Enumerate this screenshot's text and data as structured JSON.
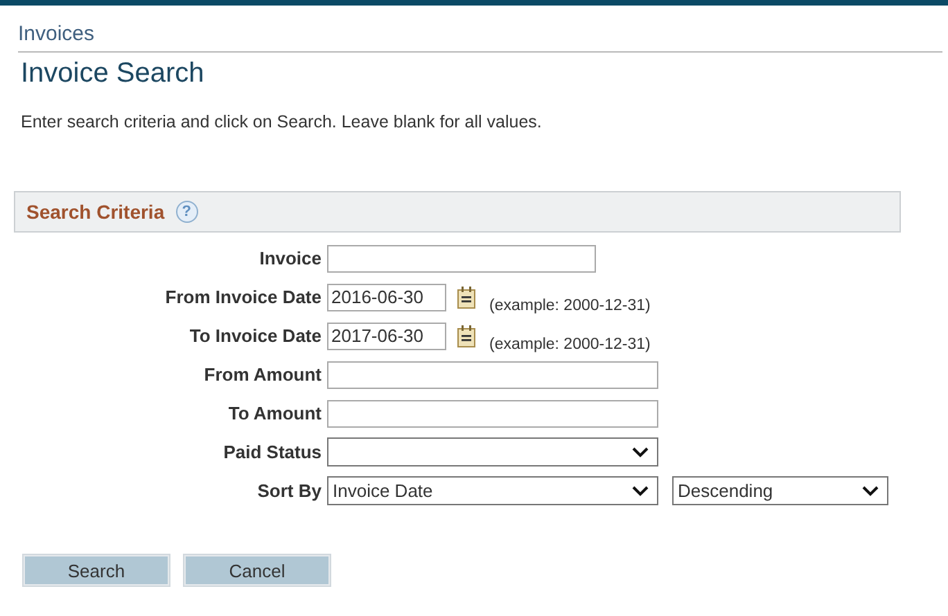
{
  "breadcrumb": "Invoices",
  "page_title": "Invoice Search",
  "instructions": "Enter search criteria and click on Search. Leave blank for all values.",
  "section": {
    "title": "Search Criteria",
    "help": "?"
  },
  "fields": [
    {
      "kind": "text",
      "label": "Invoice"
    },
    {
      "kind": "date",
      "label": "From Invoice Date",
      "value": "2016-06-30",
      "example": "(example: 2000-12-31)"
    },
    {
      "kind": "date",
      "label": "To Invoice Date",
      "value": "2017-06-30",
      "example": "(example: 2000-12-31)"
    },
    {
      "kind": "amount",
      "label": "From Amount"
    },
    {
      "kind": "amount",
      "label": "To Amount"
    },
    {
      "kind": "select",
      "label": "Paid Status"
    },
    {
      "kind": "sort",
      "label": "Sort By",
      "value": "Invoice Date",
      "order": "Descending"
    }
  ],
  "buttons": [
    "Search",
    "Cancel"
  ]
}
